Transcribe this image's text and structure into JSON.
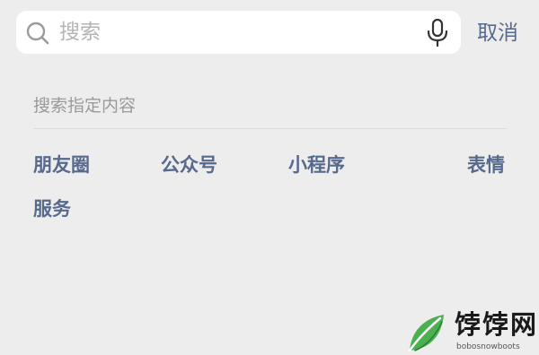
{
  "search": {
    "placeholder": "搜索",
    "value": ""
  },
  "cancel_label": "取消",
  "section_title": "搜索指定内容",
  "categories": [
    "朋友圈",
    "公众号",
    "小程序",
    "表情",
    "服务"
  ],
  "watermark": {
    "title": "饽饽网",
    "subtitle": "bobosnowboots"
  },
  "colors": {
    "background": "#ededed",
    "link": "#57698c",
    "hint": "#9a9a9a",
    "placeholder": "#b4b4b4"
  },
  "icons": {
    "search": "search-icon",
    "mic": "microphone-icon"
  }
}
